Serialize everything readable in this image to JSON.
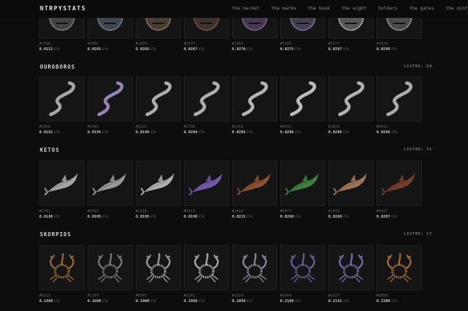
{
  "nav": {
    "logo": "NTRPYSTATS",
    "menu": [
      "the market",
      "the marks",
      "the book",
      "the eight",
      "holders",
      "the gates",
      "the mint"
    ]
  },
  "colors": {
    "background": "#0d0d0d",
    "card": "#151515",
    "text": "#cfcfcf"
  },
  "top_row": {
    "items": [
      {
        "id": "#2556",
        "price": "0.0151",
        "unit": "ETH",
        "tint": "#9a9a9a"
      },
      {
        "id": "#2685",
        "price": "0.0265",
        "unit": "ETH",
        "tint": "#8aa0b8"
      },
      {
        "id": "#2420",
        "price": "0.0265",
        "unit": "ETH",
        "tint": "#a88a70"
      },
      {
        "id": "#2576",
        "price": "0.0267",
        "unit": "ETH",
        "tint": "#8a6a5a"
      },
      {
        "id": "#1865",
        "price": "0.0270",
        "unit": "ETH",
        "tint": "#9a7ab8"
      },
      {
        "id": "#3183",
        "price": "0.0275",
        "unit": "ETH",
        "tint": "#a08ac0"
      },
      {
        "id": "#1277",
        "price": "0.0287",
        "unit": "ETH",
        "tint": "#cfcfcf"
      },
      {
        "id": "#3028",
        "price": "0.0299",
        "unit": "ETH",
        "tint": "#b0b0b0"
      }
    ]
  },
  "sections": [
    {
      "title": "OUROBOROS",
      "listed": "LISTED: 50",
      "icon": "serpent",
      "items": [
        {
          "id": "#1668",
          "price": "0.0181",
          "unit": "ETH",
          "tint": "#b5b5b5"
        },
        {
          "id": "#1393",
          "price": "0.0195",
          "unit": "ETH",
          "tint": "#a08ac8"
        },
        {
          "id": "#3216",
          "price": "0.0199",
          "unit": "ETH",
          "tint": "#bdbdbd"
        },
        {
          "id": "#2708",
          "price": "0.0204",
          "unit": "ETH",
          "tint": "#c0c0c0"
        },
        {
          "id": "#3169",
          "price": "0.0205",
          "unit": "ETH",
          "tint": "#c8c8c8"
        },
        {
          "id": "#0605",
          "price": "0.0206",
          "unit": "ETH",
          "tint": "#d0d0d0"
        },
        {
          "id": "#2826",
          "price": "0.0206",
          "unit": "ETH",
          "tint": "#c4c4c4"
        },
        {
          "id": "#0431",
          "price": "0.0208",
          "unit": "ETH",
          "tint": "#bcbcbc"
        }
      ]
    },
    {
      "title": "KETOS",
      "listed": "LISTED: 51",
      "icon": "whale",
      "items": [
        {
          "id": "#1791",
          "price": "0.0188",
          "unit": "ETH",
          "tint": "#c8c8c8"
        },
        {
          "id": "#0383",
          "price": "0.0195",
          "unit": "ETH",
          "tint": "#b8b8b8"
        },
        {
          "id": "#1418",
          "price": "0.0195",
          "unit": "ETH",
          "tint": "#d4d4d4"
        },
        {
          "id": "#0313",
          "price": "0.0198",
          "unit": "ETH",
          "tint": "#8a6ad0"
        },
        {
          "id": "#2810",
          "price": "0.0215",
          "unit": "ETH",
          "tint": "#a8603a"
        },
        {
          "id": "#0073",
          "price": "0.0260",
          "unit": "ETH",
          "tint": "#4a9a4a"
        },
        {
          "id": "#1410",
          "price": "0.0260",
          "unit": "ETH",
          "tint": "#c08a6a"
        },
        {
          "id": "#0427",
          "price": "0.0287",
          "unit": "ETH",
          "tint": "#8a4a30"
        }
      ]
    },
    {
      "title": "SKORPIOS",
      "listed": "LISTED: 17",
      "icon": "scorpion",
      "items": [
        {
          "id": "#0315",
          "price": "0.1480",
          "unit": "ETH",
          "tint": "#a8783a"
        },
        {
          "id": "#1269",
          "price": "0.1690",
          "unit": "ETH",
          "tint": "#8a8a8a"
        },
        {
          "id": "#0545",
          "price": "0.1900",
          "unit": "ETH",
          "tint": "#b0b0b0"
        },
        {
          "id": "#3281",
          "price": "0.1950",
          "unit": "ETH",
          "tint": "#c0c0c0"
        },
        {
          "id": "#1924",
          "price": "0.2050",
          "unit": "ETH",
          "tint": "#9a9ab0"
        },
        {
          "id": "#1904",
          "price": "0.2100",
          "unit": "ETH",
          "tint": "#7a6aa8"
        },
        {
          "id": "#2327",
          "price": "0.2141",
          "unit": "ETH",
          "tint": "#8a78b8"
        },
        {
          "id": "#2699",
          "price": "0.2300",
          "unit": "ETH",
          "tint": "#b8783a"
        }
      ]
    }
  ]
}
